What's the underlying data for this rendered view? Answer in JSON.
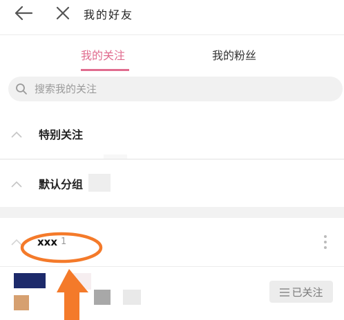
{
  "header": {
    "title": "我的好友",
    "back_icon": "arrow-left-icon",
    "close_icon": "close-icon"
  },
  "tabs": [
    {
      "label": "我的关注",
      "active": true
    },
    {
      "label": "我的粉丝",
      "active": false
    }
  ],
  "search": {
    "placeholder": "搜索我的关注",
    "value": "",
    "icon": "search-icon"
  },
  "groups": [
    {
      "label": "特别关注",
      "expanded": true
    },
    {
      "label": "默认分组",
      "expanded": true
    },
    {
      "label": "xxx",
      "count": "1",
      "expanded": true
    }
  ],
  "list_items": [
    {
      "follow_label": "已关注",
      "icon": "menu-icon"
    }
  ],
  "colors": {
    "accent": "#e06b8e",
    "annotation": "#f47a2a",
    "button_bg": "#ececec",
    "page_bg": "#f2f2f2"
  }
}
